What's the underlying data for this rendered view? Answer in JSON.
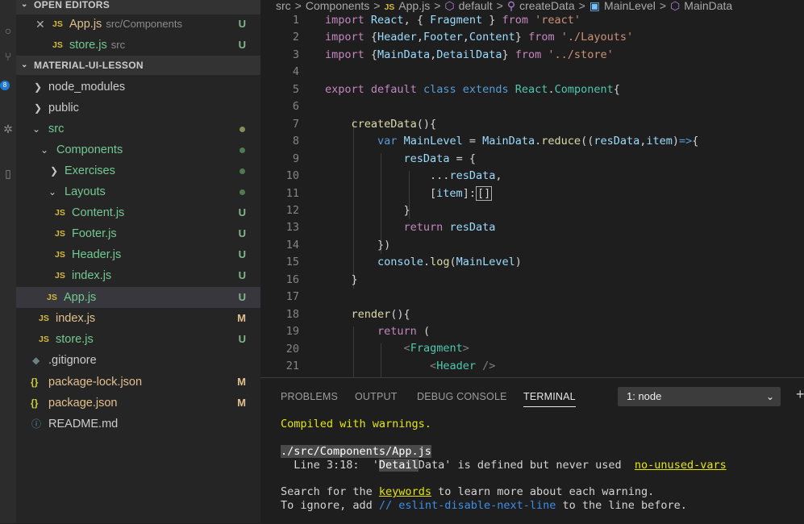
{
  "activity_bar": {
    "badge": "8"
  },
  "sidebar": {
    "open_editors": {
      "title": "OPEN EDITORS",
      "items": [
        {
          "label": "App.js",
          "path": "src/Components",
          "status": "U"
        },
        {
          "label": "store.js",
          "path": "src",
          "status": "U"
        }
      ]
    },
    "project": {
      "title": "MATERIAL-UI-LESSON",
      "items": [
        {
          "label": "node_modules"
        },
        {
          "label": "public"
        },
        {
          "label": "src"
        },
        {
          "label": "Components"
        },
        {
          "label": "Exercises"
        },
        {
          "label": "Layouts"
        },
        {
          "label": "Content.js",
          "status": "U"
        },
        {
          "label": "Footer.js",
          "status": "U"
        },
        {
          "label": "Header.js",
          "status": "U"
        },
        {
          "label": "index.js",
          "status": "U"
        },
        {
          "label": "App.js",
          "status": "U"
        },
        {
          "label": "index.js",
          "status": "M"
        },
        {
          "label": "store.js",
          "status": "U"
        },
        {
          "label": ".gitignore"
        },
        {
          "label": "package-lock.json",
          "status": "M"
        },
        {
          "label": "package.json",
          "status": "M"
        },
        {
          "label": "README.md"
        }
      ]
    }
  },
  "breadcrumbs": [
    "src",
    ">",
    "Components",
    ">",
    "App.js",
    ">",
    "default",
    ">",
    "createData",
    ">",
    "MainLevel",
    ">",
    "MainData"
  ],
  "editor": {
    "line_numbers": [
      "1",
      "2",
      "3",
      "4",
      "5",
      "6",
      "7",
      "8",
      "9",
      "10",
      "11",
      "12",
      "13",
      "14",
      "15",
      "16",
      "17",
      "18",
      "19",
      "20",
      "21"
    ]
  },
  "panel": {
    "tabs": [
      "PROBLEMS",
      "OUTPUT",
      "DEBUG CONSOLE",
      "TERMINAL"
    ],
    "terminal_select": "1: node",
    "terminal": {
      "compiled": "Compiled with warnings.",
      "file": "./src/Components/App.js",
      "warn_prefix": "  Line 3:18:  '",
      "warn_hl": "Detail",
      "warn_rest": "Data' is defined but never used  ",
      "warn_rule": "no-unused-vars",
      "search_prefix": "Search for the ",
      "search_keywords": "keywords",
      "search_suffix": " to learn more about each warning.",
      "ignore_prefix": "To ignore, add ",
      "ignore_comment": "// eslint-disable-next-line",
      "ignore_suffix": " to the line before."
    }
  }
}
